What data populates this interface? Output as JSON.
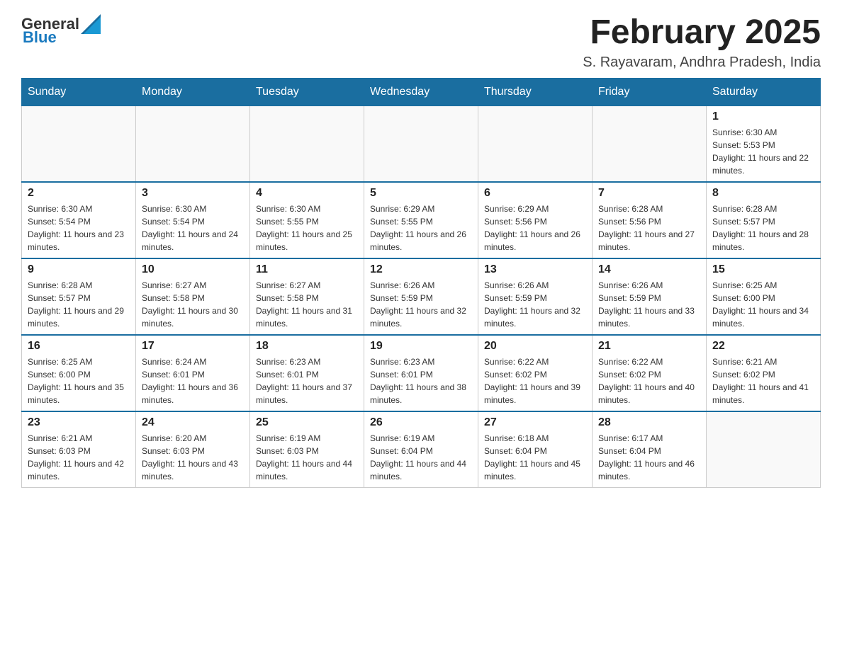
{
  "header": {
    "logo_general": "General",
    "logo_blue": "Blue",
    "title": "February 2025",
    "subtitle": "S. Rayavaram, Andhra Pradesh, India"
  },
  "days_of_week": [
    "Sunday",
    "Monday",
    "Tuesday",
    "Wednesday",
    "Thursday",
    "Friday",
    "Saturday"
  ],
  "weeks": [
    [
      {
        "day": "",
        "info": ""
      },
      {
        "day": "",
        "info": ""
      },
      {
        "day": "",
        "info": ""
      },
      {
        "day": "",
        "info": ""
      },
      {
        "day": "",
        "info": ""
      },
      {
        "day": "",
        "info": ""
      },
      {
        "day": "1",
        "info": "Sunrise: 6:30 AM\nSunset: 5:53 PM\nDaylight: 11 hours and 22 minutes."
      }
    ],
    [
      {
        "day": "2",
        "info": "Sunrise: 6:30 AM\nSunset: 5:54 PM\nDaylight: 11 hours and 23 minutes."
      },
      {
        "day": "3",
        "info": "Sunrise: 6:30 AM\nSunset: 5:54 PM\nDaylight: 11 hours and 24 minutes."
      },
      {
        "day": "4",
        "info": "Sunrise: 6:30 AM\nSunset: 5:55 PM\nDaylight: 11 hours and 25 minutes."
      },
      {
        "day": "5",
        "info": "Sunrise: 6:29 AM\nSunset: 5:55 PM\nDaylight: 11 hours and 26 minutes."
      },
      {
        "day": "6",
        "info": "Sunrise: 6:29 AM\nSunset: 5:56 PM\nDaylight: 11 hours and 26 minutes."
      },
      {
        "day": "7",
        "info": "Sunrise: 6:28 AM\nSunset: 5:56 PM\nDaylight: 11 hours and 27 minutes."
      },
      {
        "day": "8",
        "info": "Sunrise: 6:28 AM\nSunset: 5:57 PM\nDaylight: 11 hours and 28 minutes."
      }
    ],
    [
      {
        "day": "9",
        "info": "Sunrise: 6:28 AM\nSunset: 5:57 PM\nDaylight: 11 hours and 29 minutes."
      },
      {
        "day": "10",
        "info": "Sunrise: 6:27 AM\nSunset: 5:58 PM\nDaylight: 11 hours and 30 minutes."
      },
      {
        "day": "11",
        "info": "Sunrise: 6:27 AM\nSunset: 5:58 PM\nDaylight: 11 hours and 31 minutes."
      },
      {
        "day": "12",
        "info": "Sunrise: 6:26 AM\nSunset: 5:59 PM\nDaylight: 11 hours and 32 minutes."
      },
      {
        "day": "13",
        "info": "Sunrise: 6:26 AM\nSunset: 5:59 PM\nDaylight: 11 hours and 32 minutes."
      },
      {
        "day": "14",
        "info": "Sunrise: 6:26 AM\nSunset: 5:59 PM\nDaylight: 11 hours and 33 minutes."
      },
      {
        "day": "15",
        "info": "Sunrise: 6:25 AM\nSunset: 6:00 PM\nDaylight: 11 hours and 34 minutes."
      }
    ],
    [
      {
        "day": "16",
        "info": "Sunrise: 6:25 AM\nSunset: 6:00 PM\nDaylight: 11 hours and 35 minutes."
      },
      {
        "day": "17",
        "info": "Sunrise: 6:24 AM\nSunset: 6:01 PM\nDaylight: 11 hours and 36 minutes."
      },
      {
        "day": "18",
        "info": "Sunrise: 6:23 AM\nSunset: 6:01 PM\nDaylight: 11 hours and 37 minutes."
      },
      {
        "day": "19",
        "info": "Sunrise: 6:23 AM\nSunset: 6:01 PM\nDaylight: 11 hours and 38 minutes."
      },
      {
        "day": "20",
        "info": "Sunrise: 6:22 AM\nSunset: 6:02 PM\nDaylight: 11 hours and 39 minutes."
      },
      {
        "day": "21",
        "info": "Sunrise: 6:22 AM\nSunset: 6:02 PM\nDaylight: 11 hours and 40 minutes."
      },
      {
        "day": "22",
        "info": "Sunrise: 6:21 AM\nSunset: 6:02 PM\nDaylight: 11 hours and 41 minutes."
      }
    ],
    [
      {
        "day": "23",
        "info": "Sunrise: 6:21 AM\nSunset: 6:03 PM\nDaylight: 11 hours and 42 minutes."
      },
      {
        "day": "24",
        "info": "Sunrise: 6:20 AM\nSunset: 6:03 PM\nDaylight: 11 hours and 43 minutes."
      },
      {
        "day": "25",
        "info": "Sunrise: 6:19 AM\nSunset: 6:03 PM\nDaylight: 11 hours and 44 minutes."
      },
      {
        "day": "26",
        "info": "Sunrise: 6:19 AM\nSunset: 6:04 PM\nDaylight: 11 hours and 44 minutes."
      },
      {
        "day": "27",
        "info": "Sunrise: 6:18 AM\nSunset: 6:04 PM\nDaylight: 11 hours and 45 minutes."
      },
      {
        "day": "28",
        "info": "Sunrise: 6:17 AM\nSunset: 6:04 PM\nDaylight: 11 hours and 46 minutes."
      },
      {
        "day": "",
        "info": ""
      }
    ]
  ]
}
